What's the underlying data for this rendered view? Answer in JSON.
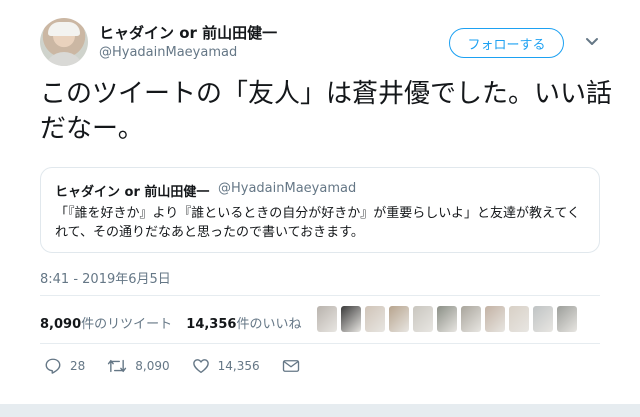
{
  "author": {
    "display_name": "ヒャダイン or 前山田健一",
    "handle": "@HyadainMaeyamad"
  },
  "follow_button_label": "フォローする",
  "tweet": {
    "text": "このツイートの「友人」は蒼井優でした。いい話だなー。"
  },
  "quoted_tweet": {
    "display_name": "ヒャダイン or 前山田健一",
    "handle": "@HyadainMaeyamad",
    "text": "「『誰を好きか』より『誰といるときの自分が好きか』が重要らしいよ」と友達が教えてくれて、その通りだなあと思ったので書いておきます。"
  },
  "timestamp": "8:41 - 2019年6月5日",
  "stats": {
    "retweets_count": "8,090",
    "retweets_suffix": "件のリツイート",
    "likes_count": "14,356",
    "likes_suffix": "件のいいね"
  },
  "actions": {
    "reply_count": "28",
    "retweet_count": "8,090",
    "like_count": "14,356"
  },
  "colors": {
    "accent": "#1da1f2",
    "text": "#14171a",
    "muted": "#657786",
    "border": "#e1e8ed"
  },
  "icons": {
    "caret": "chevron-down-icon",
    "reply": "reply-icon",
    "retweet": "retweet-icon",
    "like": "heart-icon",
    "dm": "mail-icon"
  },
  "liker_avatar_colors": [
    "#b9b3ad",
    "#3a3a3a",
    "#d0c4b8",
    "#b7a48e",
    "#c9c6bf",
    "#8b8f86",
    "#a9a59c",
    "#c3b2a4",
    "#d8d0c6",
    "#bfc3c4",
    "#9c9e9a"
  ]
}
